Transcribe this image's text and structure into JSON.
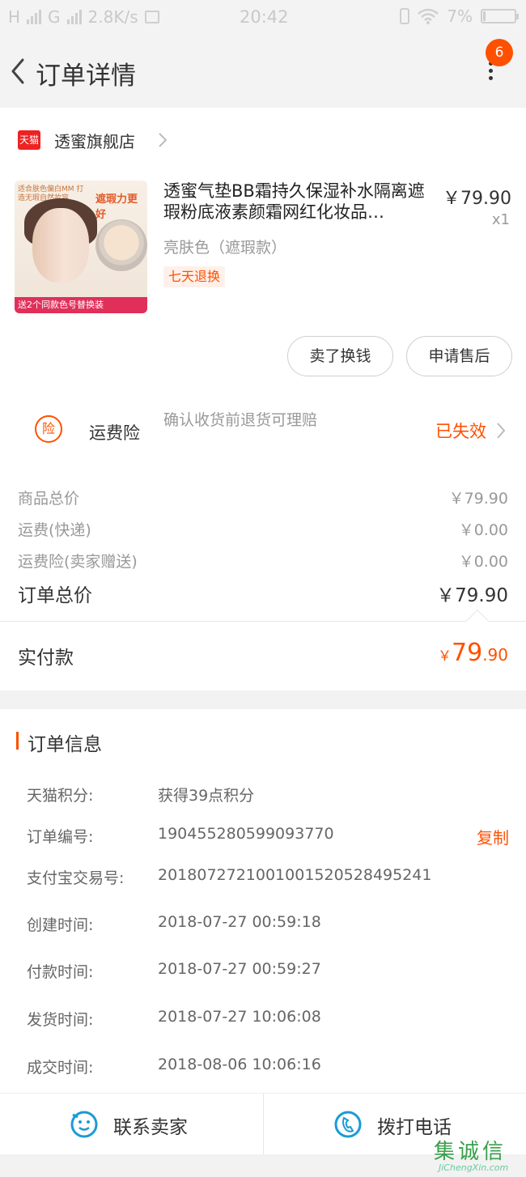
{
  "status_bar": {
    "carrier_left": "H",
    "carrier_mid": "G",
    "speed": "2.8K/s",
    "time": "20:42",
    "battery": "7%",
    "battery_fraction": 0.07
  },
  "nav": {
    "title": "订单详情",
    "badge_count": "6"
  },
  "shop": {
    "logo_text": "天猫",
    "name": "透蜜旗舰店"
  },
  "product": {
    "image_texts": {
      "promo_top": "适合肤色偏白MM 打造无瑕自然妆容",
      "headline": "遮瑕力更好",
      "bottom_strip": "送2个同款色号替换装"
    },
    "title": "透蜜气垫BB霜持久保湿补水隔离遮瑕粉底液素颜霜网红化妆品…",
    "price": "￥79.90",
    "quantity": "x1",
    "sku": "亮肤色（遮瑕款）",
    "service_tag": "七天退换"
  },
  "buttons": {
    "exchange": "卖了换钱",
    "after_sale": "申请售后"
  },
  "insurance": {
    "icon_text": "险",
    "name": "运费险",
    "description": "确认收货前退货可理赔",
    "status": "已失效"
  },
  "summary": [
    {
      "label": "商品总价",
      "value": "￥79.90"
    },
    {
      "label": "运费(快递)",
      "value": "￥0.00"
    },
    {
      "label": "运费险(卖家赠送)",
      "value": "￥0.00"
    }
  ],
  "order_total": {
    "label": "订单总价",
    "value": "￥79.90"
  },
  "paid": {
    "label": "实付款",
    "currency": "￥",
    "integer": "79",
    "decimal": ".90"
  },
  "order_info": {
    "title": "订单信息",
    "rows": [
      {
        "key": "天猫积分:",
        "value": "获得39点积分"
      },
      {
        "key": "订单编号:",
        "value": "190455280599093770"
      },
      {
        "key": "支付宝交易号:",
        "value": "2018072721001001520528495241"
      },
      {
        "key": "创建时间:",
        "value": "2018-07-27 00:59:18"
      },
      {
        "key": "付款时间:",
        "value": "2018-07-27 00:59:27"
      },
      {
        "key": "发货时间:",
        "value": "2018-07-27 10:06:08"
      },
      {
        "key": "成交时间:",
        "value": "2018-08-06 10:06:16"
      }
    ],
    "copy_label": "复制"
  },
  "actions": {
    "contact_seller": "联系卖家",
    "call": "拨打电话"
  },
  "watermark": {
    "text": "集诚信",
    "url": "JiChengXin.com"
  },
  "colors": {
    "accent": "#ff5000",
    "tmall_red": "#ee2222",
    "action_blue": "#1a9bd7"
  }
}
